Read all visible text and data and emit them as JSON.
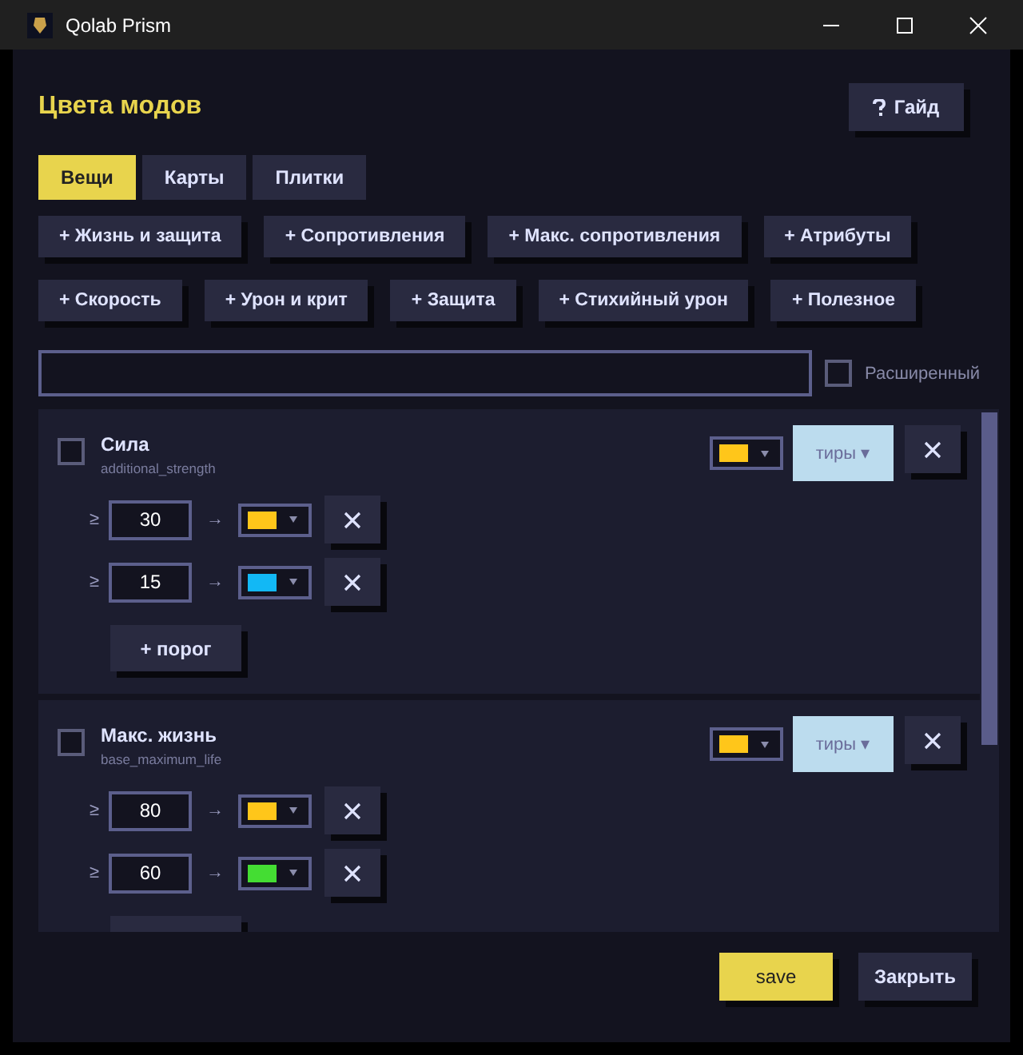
{
  "window": {
    "title": "Qolab Prism"
  },
  "header": {
    "title": "Цвета модов",
    "guide_button": "Гайд"
  },
  "tabs": [
    {
      "label": "Вещи",
      "selected": true
    },
    {
      "label": "Карты",
      "selected": false
    },
    {
      "label": "Плитки",
      "selected": false
    }
  ],
  "category_buttons": [
    [
      "+ Жизнь и защита",
      "+ Сопротивления",
      "+ Макс. сопротивления",
      "+ Атрибуты"
    ],
    [
      "+ Скорость",
      "+ Урон и крит",
      "+ Защита",
      "+ Стихийный урон",
      "+ Полезное"
    ]
  ],
  "search": {
    "advanced_label": "Расширенный",
    "advanced_checked": false
  },
  "mods": [
    {
      "name": "Сила",
      "id": "additional_strength",
      "checked": false,
      "color": "#ffc61a",
      "tiers_label": "тиры ▾",
      "tiers_disabled": true,
      "thresholds": [
        {
          "sign": "≥",
          "value": "30",
          "arrow": "→",
          "color": "#ffc61a"
        },
        {
          "sign": "≥",
          "value": "15",
          "arrow": "→",
          "color": "#12b8f5"
        }
      ],
      "add_label": "+ порог"
    },
    {
      "name": "Макс. жизнь",
      "id": "base_maximum_life",
      "checked": false,
      "color": "#ffc61a",
      "tiers_label": "тиры ▾",
      "tiers_disabled": true,
      "thresholds": [
        {
          "sign": "≥",
          "value": "80",
          "arrow": "→",
          "color": "#ffc61a"
        },
        {
          "sign": "≥",
          "value": "60",
          "arrow": "→",
          "color": "#44dd33"
        }
      ]
    }
  ],
  "footer": {
    "save": "save",
    "close": "Закрыть"
  }
}
